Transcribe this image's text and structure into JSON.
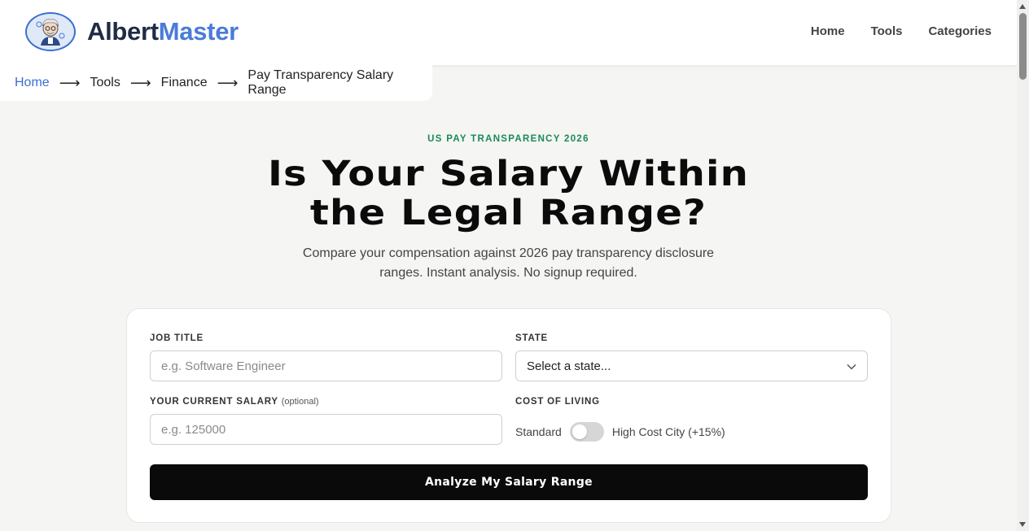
{
  "header": {
    "brand_part1": "Albert",
    "brand_part2": "Master",
    "nav": [
      "Home",
      "Tools",
      "Categories"
    ]
  },
  "breadcrumb": {
    "items": [
      "Home",
      "Tools",
      "Finance",
      "Pay Transparency Salary Range"
    ],
    "separator": "⟶"
  },
  "hero": {
    "eyebrow": "US PAY TRANSPARENCY 2026",
    "headline_line1": "Is Your Salary Within",
    "headline_line2": "the Legal Range?",
    "subtitle_line1": "Compare your compensation against 2026 pay transparency disclosure",
    "subtitle_line2": "ranges. Instant analysis. No signup required."
  },
  "form": {
    "job_title_label": "JOB TITLE",
    "job_title_placeholder": "e.g. Software Engineer",
    "job_title_value": "",
    "state_label": "STATE",
    "state_value": "Select a state...",
    "salary_label": "YOUR CURRENT SALARY",
    "salary_optional": "(optional)",
    "salary_placeholder": "e.g. 125000",
    "salary_value": "",
    "col_label": "COST OF LIVING",
    "col_left": "Standard",
    "col_right": "High Cost City (+15%)",
    "col_toggle_on": false,
    "submit_label": "Analyze My Salary Range"
  },
  "colors": {
    "accent_blue": "#4a7bd9",
    "eyebrow_green": "#1a8a5a",
    "cta_bg": "#0a0a0a"
  }
}
